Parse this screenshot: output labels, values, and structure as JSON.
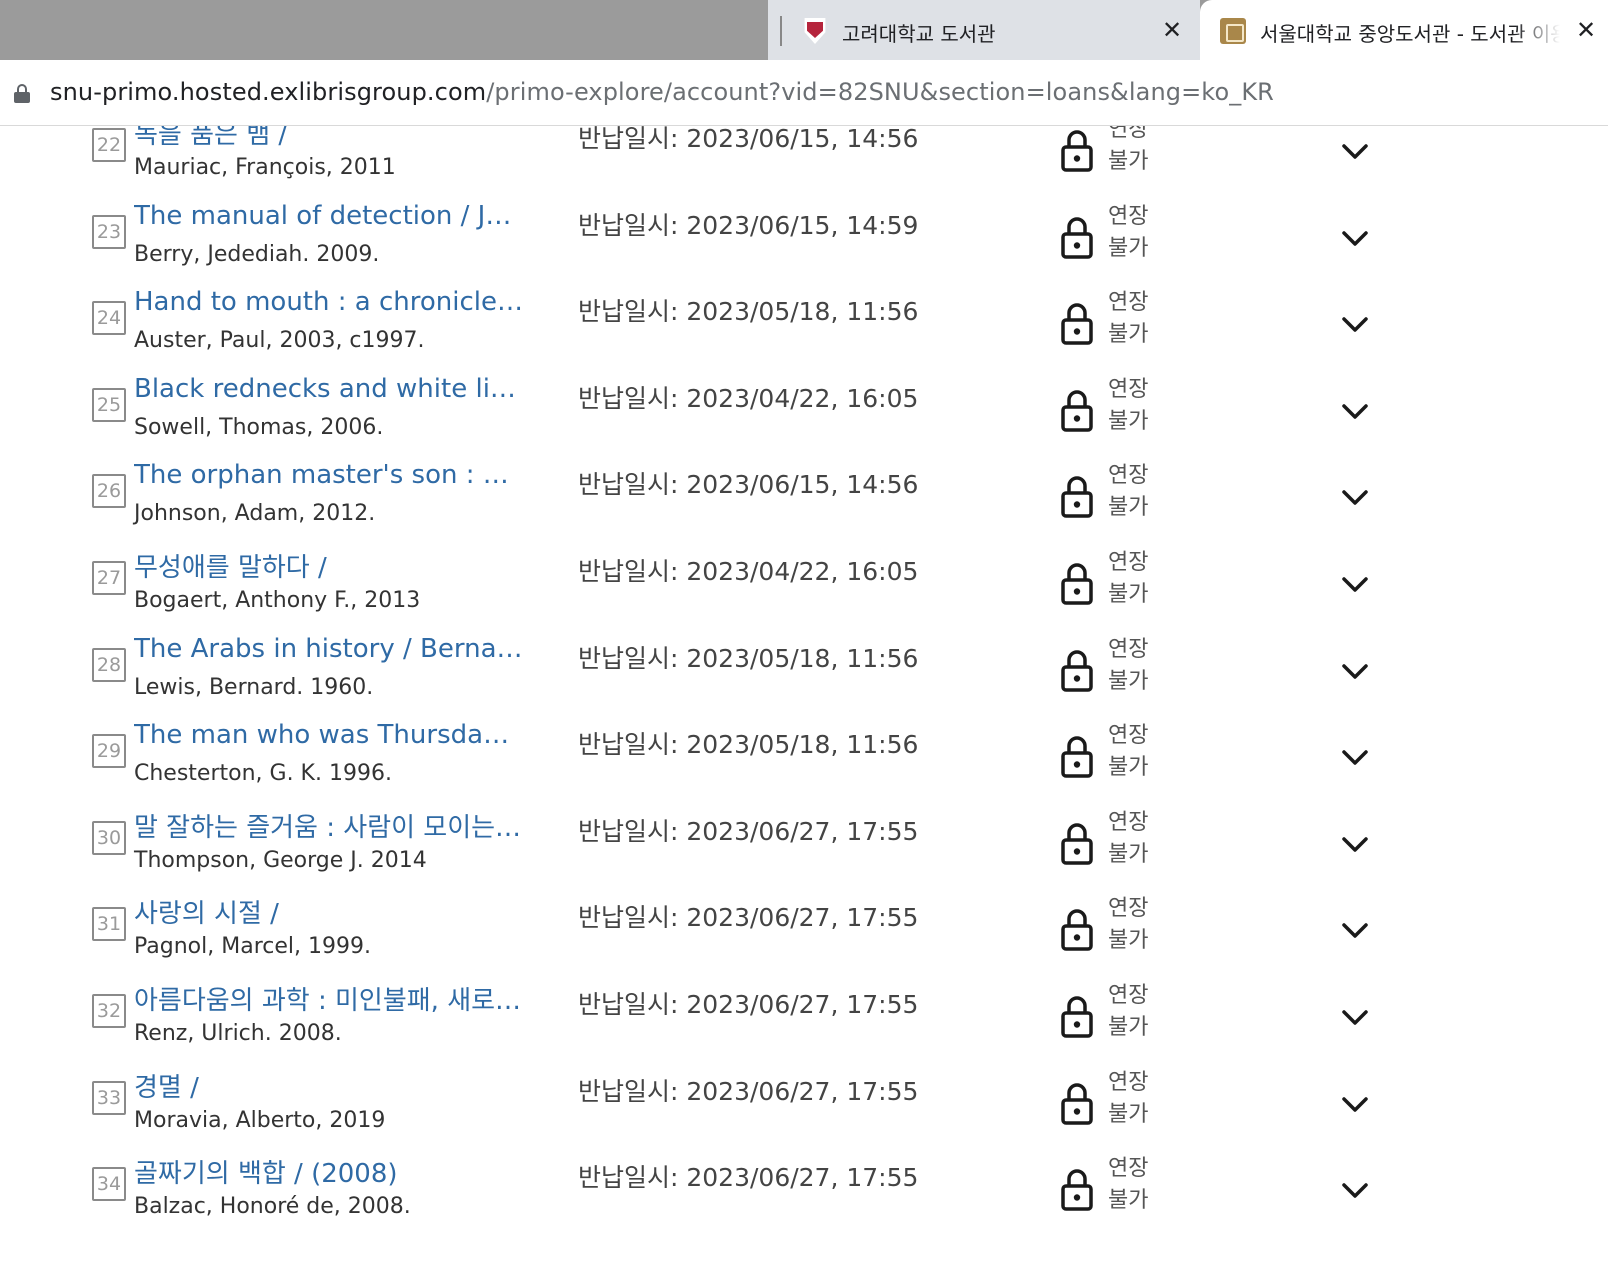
{
  "browser": {
    "tabs": [
      {
        "title": "고려대학교 도서관",
        "favicon": "ku-shield-icon",
        "active": false
      },
      {
        "title": "서울대학교 중앙도서관 - 도서관 이용",
        "favicon": "snu-library-icon",
        "active": true
      }
    ],
    "url_host": "snu-primo.hosted.exlibrisgroup.com",
    "url_path": "/primo-explore/account?vid=82SNU&section=loans&lang=ko_KR"
  },
  "loans": [
    {
      "num": "22",
      "title": "녹을 품은 뱀 /",
      "author": "Mauriac, François, 2011",
      "due": "반납일시: 2023/06/15, 14:56",
      "status_line1": "연장",
      "status_line2": "불가"
    },
    {
      "num": "23",
      "title": "The manual of detection / Jedediah Berry.",
      "author": "Berry, Jedediah. 2009.",
      "due": "반납일시: 2023/06/15, 14:59",
      "status_line1": "연장",
      "status_line2": "불가"
    },
    {
      "num": "24",
      "title": "Hand to mouth : a chronicle of early failure",
      "author": "Auster, Paul, 2003, c1997.",
      "due": "반납일시: 2023/05/18, 11:56",
      "status_line1": "연장",
      "status_line2": "불가"
    },
    {
      "num": "25",
      "title": "Black rednecks and white liberals",
      "author": "Sowell, Thomas, 2006.",
      "due": "반납일시: 2023/04/22, 16:05",
      "status_line1": "연장",
      "status_line2": "불가"
    },
    {
      "num": "26",
      "title": "The orphan master's son : a novel",
      "author": "Johnson, Adam, 2012.",
      "due": "반납일시: 2023/06/15, 14:56",
      "status_line1": "연장",
      "status_line2": "불가"
    },
    {
      "num": "27",
      "title": "무성애를 말하다 /",
      "author": "Bogaert, Anthony F., 2013",
      "due": "반납일시: 2023/04/22, 16:05",
      "status_line1": "연장",
      "status_line2": "불가"
    },
    {
      "num": "28",
      "title": "The Arabs in history / Bernard Lewis.",
      "author": "Lewis, Bernard. 1960.",
      "due": "반납일시: 2023/05/18, 11:56",
      "status_line1": "연장",
      "status_line2": "불가"
    },
    {
      "num": "29",
      "title": "The man who was Thursday, a nightmare",
      "author": "Chesterton, G. K. 1996.",
      "due": "반납일시: 2023/05/18, 11:56",
      "status_line1": "연장",
      "status_line2": "불가"
    },
    {
      "num": "30",
      "title": "말 잘하는 즐거움 : 사람이 모이는 대화법",
      "author": "Thompson, George J. 2014",
      "due": "반납일시: 2023/06/27, 17:55",
      "status_line1": "연장",
      "status_line2": "불가"
    },
    {
      "num": "31",
      "title": "사랑의 시절 /",
      "author": "Pagnol, Marcel, 1999.",
      "due": "반납일시: 2023/06/27, 17:55",
      "status_line1": "연장",
      "status_line2": "불가"
    },
    {
      "num": "32",
      "title": "아름다움의 과학 : 미인불패, 새로운 권력의 발견",
      "author": "Renz, Ulrich. 2008.",
      "due": "반납일시: 2023/06/27, 17:55",
      "status_line1": "연장",
      "status_line2": "불가"
    },
    {
      "num": "33",
      "title": "경멸 /",
      "author": "Moravia, Alberto, 2019",
      "due": "반납일시: 2023/06/27, 17:55",
      "status_line1": "연장",
      "status_line2": "불가"
    },
    {
      "num": "34",
      "title": "골짜기의 백합 / (2008)",
      "author": "Balzac, Honoré de, 2008.",
      "due": "반납일시: 2023/06/27, 17:55",
      "status_line1": "연장",
      "status_line2": "불가"
    }
  ]
}
